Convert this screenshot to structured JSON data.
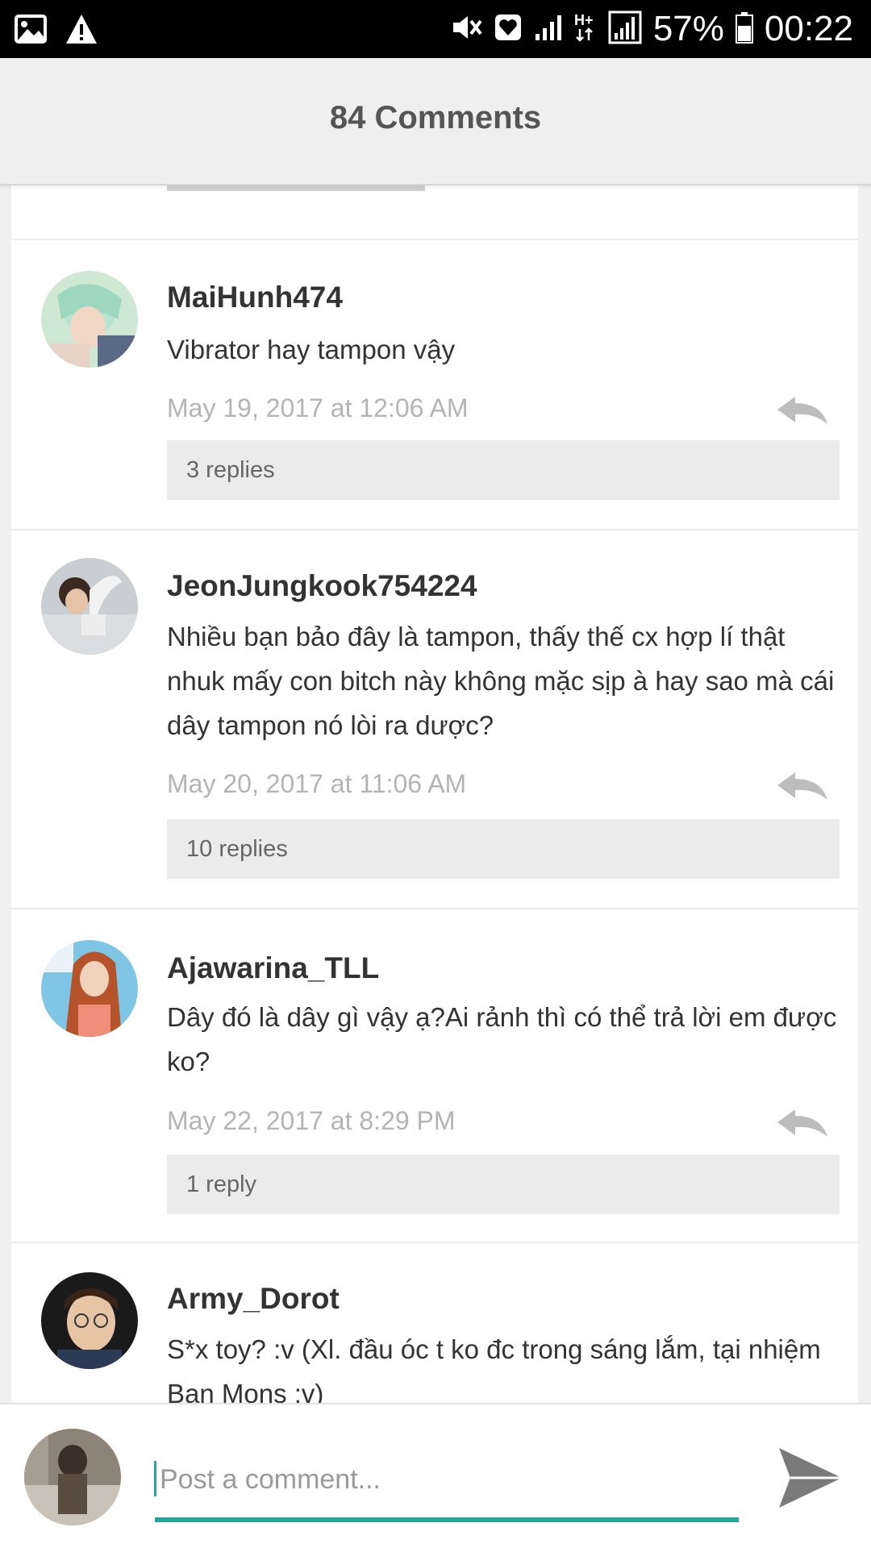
{
  "status_bar": {
    "battery": "57%",
    "time": "00:22",
    "icons": [
      "image-icon",
      "warning-icon",
      "mute-icon",
      "heart-box-icon",
      "signal-icon",
      "hplus-icon",
      "signal-full-icon",
      "battery-icon"
    ]
  },
  "header": {
    "title": "84 Comments"
  },
  "comments": [
    {
      "author": "MaiHunh474",
      "text": "Vibrator hay tampon vậy",
      "date": "May 19, 2017 at 12:06 AM",
      "replies": "3 replies"
    },
    {
      "author": "JeonJungkook754224",
      "text": "Nhiều bạn bảo đây là tampon, thấy thế cx hợp lí thật nhuk mấy con bitch này không mặc sịp à hay sao mà cái dây tampon nó lòi ra dược?",
      "date": "May 20, 2017 at 11:06 AM",
      "replies": "10 replies"
    },
    {
      "author": "Ajawarina_TLL",
      "text": "Dây đó là dây gì vậy ạ?Ai rảnh thì có thể trả lời em được ko?",
      "date": "May 22, 2017 at 8:29 PM",
      "replies": "1 reply"
    },
    {
      "author": "Army_Dorot",
      "text": "S*x toy? :v (Xl. đầu óc t ko đc trong sáng lắm, tại nhiệm Ban Mons :v)"
    }
  ],
  "composer": {
    "placeholder": "Post a comment...",
    "accent_color": "#26a69a"
  }
}
